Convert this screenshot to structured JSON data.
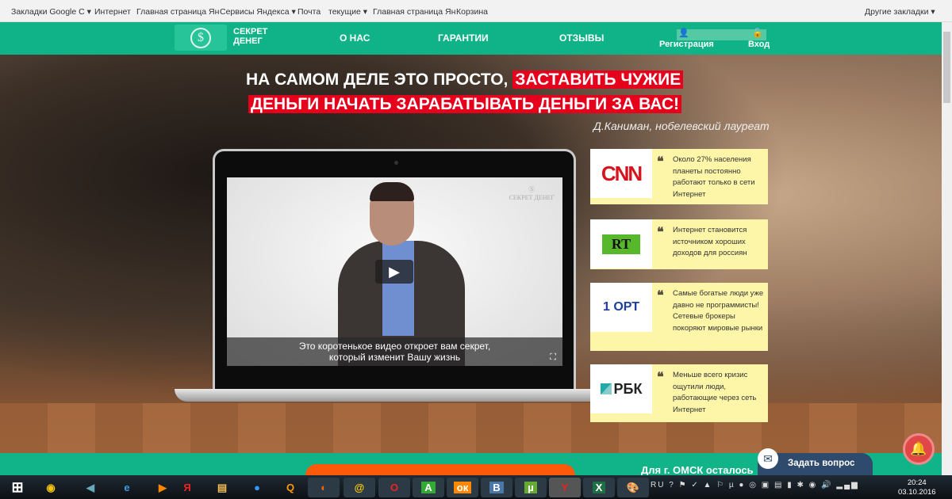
{
  "bookmarks": {
    "items": [
      "Закладки Google C ▾",
      "Интернет",
      "Главная страница Ян",
      "Сервисы Яндекса ▾",
      "Почта",
      "текущие ▾",
      "Главная страница Ян",
      "Корзина"
    ],
    "other": "Другие закладки ▾"
  },
  "header": {
    "logo_line1": "СЕКРЕТ",
    "logo_line2": "ДЕНЕГ",
    "logo_symbol": "$",
    "nav": [
      "О НАС",
      "ГАРАНТИИ",
      "ОТЗЫВЫ"
    ],
    "register": "Регистрация",
    "login": "Вход"
  },
  "hero": {
    "line1_plain": "НА САМОМ ДЕЛЕ ЭТО ПРОСТО,",
    "line1_red": "ЗАСТАВИТЬ ЧУЖИЕ",
    "line2_red": "ДЕНЬГИ  НАЧАТЬ ЗАРАБАТЫВАТЬ ДЕНЬГИ ЗА ВАС!",
    "quote_author": "Д.Каниман, нобелевский лауреат"
  },
  "video": {
    "subtitle1": "Это коротенькое видео откроет вам секрет,",
    "subtitle2": "который изменит Вашу жизнь",
    "watermark": "СЕКРЕТ ДЕНЕГ"
  },
  "cards": [
    {
      "logo": "CNN",
      "text": "Около 27% населения планеты постоянно работают только в сети Интернет",
      "color": "#d7141d"
    },
    {
      "logo": "RT",
      "text": "Интернет становится источником хороших доходов для россиян",
      "color": "#58b82b"
    },
    {
      "logo": "1 ОРТ",
      "text": "Самые богатые люди уже давно не программисты! Сетевые брокеры покоряют мировые рынки",
      "color": "#1c3f9b"
    },
    {
      "logo": "РБК",
      "text": "Меньше всего кризис ощутили люди, работающие через сеть Интернет",
      "color": "#222222"
    }
  ],
  "footer": {
    "omsk": "Для г. ОМСК осталось",
    "ask": "Задать вопрос"
  },
  "taskbar": {
    "lang": "RU",
    "time": "20:24",
    "date": "03.10.2016"
  },
  "colors": {
    "brand_green": "#0fb387",
    "accent_red": "#e5001c",
    "card_yellow": "#fdf5a8",
    "orange": "#fc5a0a"
  }
}
